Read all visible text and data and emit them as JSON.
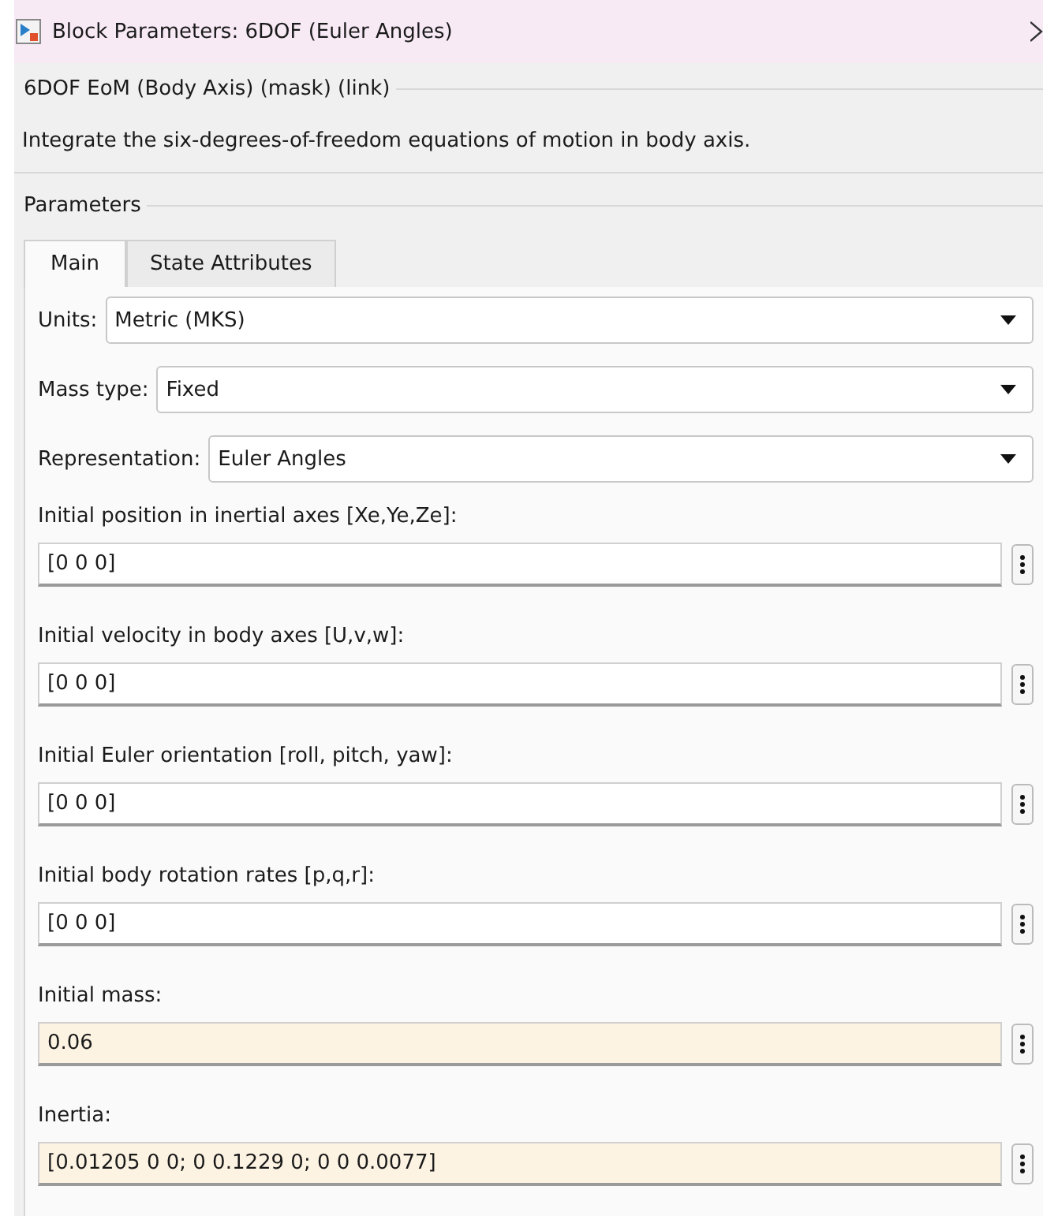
{
  "window": {
    "title": "Block Parameters: 6DOF (Euler Angles)"
  },
  "block": {
    "heading": "6DOF EoM (Body Axis) (mask) (link)",
    "description": "Integrate the six-degrees-of-freedom equations of motion in body axis."
  },
  "parameters": {
    "heading": "Parameters",
    "tabs": [
      {
        "label": "Main",
        "selected": true
      },
      {
        "label": "State Attributes",
        "selected": false
      }
    ],
    "dropdowns": [
      {
        "label": "Units:",
        "value": "Metric (MKS)"
      },
      {
        "label": "Mass type:",
        "value": "Fixed"
      },
      {
        "label": "Representation:",
        "value": "Euler Angles"
      }
    ],
    "fields": [
      {
        "label": "Initial position in inertial axes [Xe,Ye,Ze]:",
        "value": "[0 0 0]",
        "highlighted": false
      },
      {
        "label": "Initial velocity in body axes [U,v,w]:",
        "value": "[0 0 0]",
        "highlighted": false
      },
      {
        "label": "Initial Euler orientation [roll, pitch, yaw]:",
        "value": "[0 0 0]",
        "highlighted": false
      },
      {
        "label": "Initial body rotation rates [p,q,r]:",
        "value": "[0 0 0]",
        "highlighted": false
      },
      {
        "label": "Initial mass:",
        "value": "0.06",
        "highlighted": true
      },
      {
        "label": "Inertia:",
        "value": "[0.01205 0 0; 0 0.1229 0; 0 0 0.0077]",
        "highlighted": true
      }
    ]
  }
}
